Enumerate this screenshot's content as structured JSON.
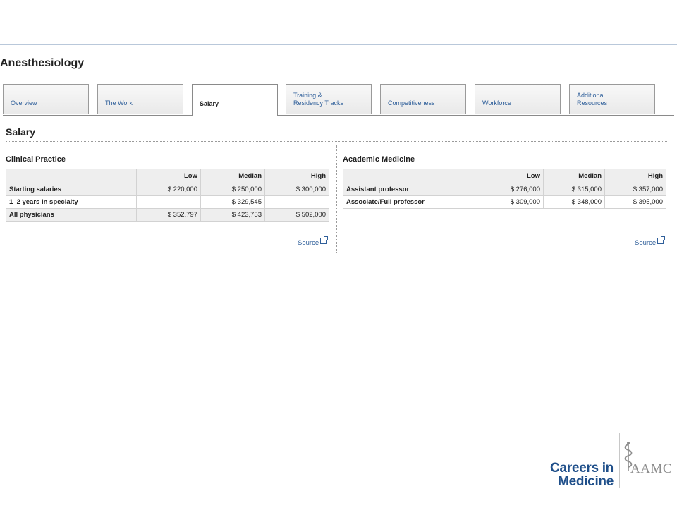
{
  "specialty_title": "Anesthesiology",
  "tabs": [
    {
      "label": "Overview"
    },
    {
      "label": "The Work"
    },
    {
      "label": "Salary",
      "active": true
    },
    {
      "label": "Training &\nResidency Tracks"
    },
    {
      "label": "Competitiveness"
    },
    {
      "label": "Workforce"
    },
    {
      "label": "Additional\nResources"
    }
  ],
  "section_title": "Salary",
  "clinical": {
    "title": "Clinical Practice",
    "headers": [
      "",
      "Low",
      "Median",
      "High"
    ],
    "rows": [
      {
        "label": "Starting salaries",
        "low": "$ 220,000",
        "median": "$ 250,000",
        "high": "$ 300,000"
      },
      {
        "label": "1–2 years in specialty",
        "low": "",
        "median": "$ 329,545",
        "high": ""
      },
      {
        "label": "All physicians",
        "low": "$ 352,797",
        "median": "$ 423,753",
        "high": "$ 502,000"
      }
    ],
    "source_label": "Source"
  },
  "academic": {
    "title": "Academic Medicine",
    "headers": [
      "",
      "Low",
      "Median",
      "High"
    ],
    "rows": [
      {
        "label": "Assistant professor",
        "low": "$ 276,000",
        "median": "$ 315,000",
        "high": "$ 357,000"
      },
      {
        "label": "Associate/Full professor",
        "low": "$ 309,000",
        "median": "$ 348,000",
        "high": "$ 395,000"
      }
    ],
    "source_label": "Source"
  },
  "logo": {
    "line1": "Careers in",
    "line2": "Medicine",
    "brand": "AAMC"
  },
  "colors": {
    "link": "#2f5f9a",
    "logo_blue": "#1f4f8a",
    "logo_gray": "#8d8d8d"
  }
}
